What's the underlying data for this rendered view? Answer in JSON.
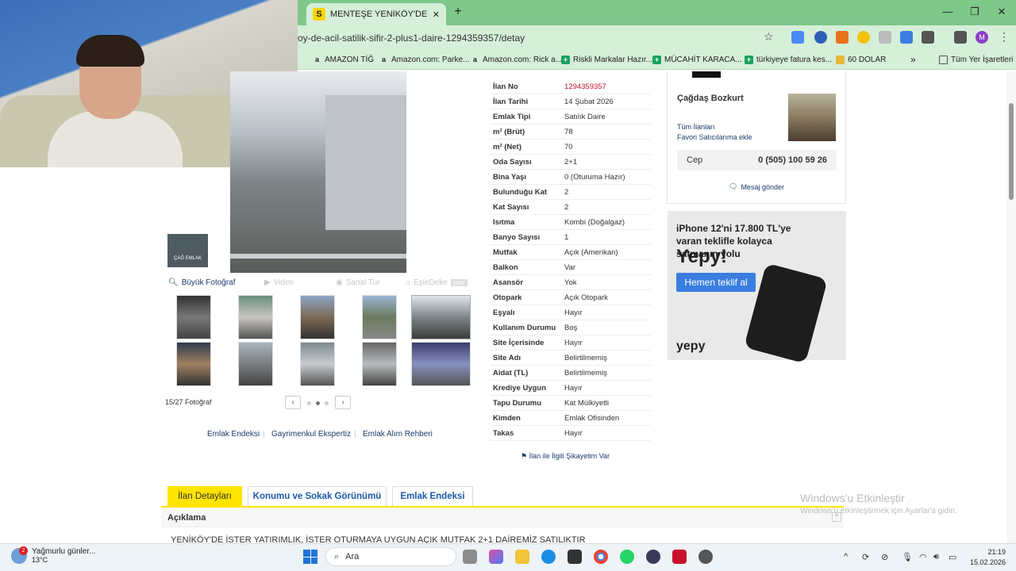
{
  "browser": {
    "tab_title": "MENTEŞE YENİKÖY'DE ACİL SAT",
    "tab_favicon": "S",
    "url": "oy-de-acil-satilik-sifir-2-plus1-daire-1294359357/detay",
    "bookmarks": [
      {
        "label": "AMAZON TİĞ",
        "icon": "a"
      },
      {
        "label": "Amazon.com: Parke...",
        "icon": "a"
      },
      {
        "label": "Amazon.com: Rick a...",
        "icon": "a"
      },
      {
        "label": "Riskli Markalar Hazır...",
        "icon": "+"
      },
      {
        "label": "MÜCAHİT KARACA...",
        "icon": "+"
      },
      {
        "label": "türkiyeye fatura kes...",
        "icon": "+"
      },
      {
        "label": "60 DOLAR",
        "icon": "folder"
      }
    ],
    "bookmarks_all": "Tüm Yer İşaretleri",
    "profile_initial": "M"
  },
  "gallery": {
    "logo_text": "ÇAĞ EMLAK",
    "tools": {
      "big_photo": "Büyük Fotoğraf",
      "video": "Video",
      "virtual_tour": "Sanal Tur",
      "property_match": "EşleDeke",
      "new_badge": "yeni"
    },
    "counter": "15/27 Fotoğraf"
  },
  "links": {
    "index": "Emlak Endeksi",
    "expertise": "Gayrimenkul Ekspertiz",
    "guide": "Emlak Alım Rehberi"
  },
  "details": [
    {
      "k": "İlan No",
      "v": "1294359357"
    },
    {
      "k": "İlan Tarihi",
      "v": "14 Şubat 2026"
    },
    {
      "k": "Emlak Tipi",
      "v": "Satılık Daire"
    },
    {
      "k": "m² (Brüt)",
      "v": "78"
    },
    {
      "k": "m² (Net)",
      "v": "70"
    },
    {
      "k": "Oda Sayısı",
      "v": "2+1"
    },
    {
      "k": "Bina Yaşı",
      "v": "0 (Oturuma Hazır)"
    },
    {
      "k": "Bulunduğu Kat",
      "v": "2"
    },
    {
      "k": "Kat Sayısı",
      "v": "2"
    },
    {
      "k": "Isıtma",
      "v": "Kombi (Doğalgaz)"
    },
    {
      "k": "Banyo Sayısı",
      "v": "1"
    },
    {
      "k": "Mutfak",
      "v": "Açık (Amerikan)"
    },
    {
      "k": "Balkon",
      "v": "Var"
    },
    {
      "k": "Asansör",
      "v": "Yok"
    },
    {
      "k": "Otopark",
      "v": "Açık Otopark"
    },
    {
      "k": "Eşyalı",
      "v": "Hayır"
    },
    {
      "k": "Kullanım Durumu",
      "v": "Boş"
    },
    {
      "k": "Site İçerisinde",
      "v": "Hayır"
    },
    {
      "k": "Site Adı",
      "v": "Belirtilmemiş"
    },
    {
      "k": "Aidat (TL)",
      "v": "Belirtilmemiş"
    },
    {
      "k": "Krediye Uygun",
      "v": "Hayır"
    },
    {
      "k": "Tapu Durumu",
      "v": "Kat Mülkiyetli"
    },
    {
      "k": "Kimden",
      "v": "Emlak Ofisinden"
    },
    {
      "k": "Takas",
      "v": "Hayır"
    }
  ],
  "complaint": "İlan ile İlgili Şikayetim Var",
  "seller": {
    "name": "Çağdaş Bozkurt",
    "all_listings": "Tüm İlanları",
    "add_favorite": "Favori Satıcılarıma ekle",
    "phone_label": "Cep",
    "phone": "0 (505) 100 59 26",
    "message": "Mesaj gönder"
  },
  "ad": {
    "headline": "iPhone 12'ni 17.800 TL'ye varan teklifle kolayca satmanın yolu",
    "brand": "Yepy!",
    "button": "Hemen teklif al",
    "logo": "yepy"
  },
  "tabs": [
    {
      "label": "İlan Detayları",
      "active": true
    },
    {
      "label": "Konumu ve Sokak Görünümü",
      "active": false
    },
    {
      "label": "Emlak Endeksi",
      "active": false
    }
  ],
  "description": {
    "title": "Açıklama",
    "text": "YENİKÖY'DE İSTER YATIRIMLIK, İSTER OTURMAYA UYGUN AÇIK MUTFAK 2+1 DAİREMİZ SATILIKTIR"
  },
  "watermark": {
    "line1": "Windows'u Etkinleştir",
    "line2": "Windows'u etkinleştirmek için Ayarlar'a gidin."
  },
  "taskbar": {
    "weather": "Yağmurlu günler...",
    "temp": "13°C",
    "weather_badge": "2",
    "search": "Ara",
    "time": "21:19",
    "date": "15.02.2026"
  },
  "colors": {
    "accent_yellow": "#ffe400",
    "link_blue": "#1a3a6b",
    "chrome_green": "#7ec88a",
    "chrome_light": "#d5efd8",
    "listing_red": "#c2182b"
  }
}
